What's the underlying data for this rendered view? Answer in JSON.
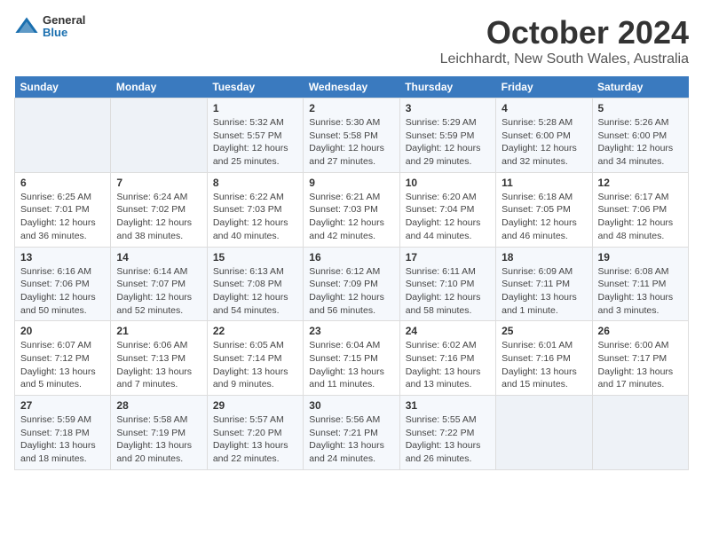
{
  "logo": {
    "general": "General",
    "blue": "Blue"
  },
  "title": "October 2024",
  "subtitle": "Leichhardt, New South Wales, Australia",
  "headers": [
    "Sunday",
    "Monday",
    "Tuesday",
    "Wednesday",
    "Thursday",
    "Friday",
    "Saturday"
  ],
  "weeks": [
    [
      {
        "day": "",
        "info": ""
      },
      {
        "day": "",
        "info": ""
      },
      {
        "day": "1",
        "info": "Sunrise: 5:32 AM\nSunset: 5:57 PM\nDaylight: 12 hours\nand 25 minutes."
      },
      {
        "day": "2",
        "info": "Sunrise: 5:30 AM\nSunset: 5:58 PM\nDaylight: 12 hours\nand 27 minutes."
      },
      {
        "day": "3",
        "info": "Sunrise: 5:29 AM\nSunset: 5:59 PM\nDaylight: 12 hours\nand 29 minutes."
      },
      {
        "day": "4",
        "info": "Sunrise: 5:28 AM\nSunset: 6:00 PM\nDaylight: 12 hours\nand 32 minutes."
      },
      {
        "day": "5",
        "info": "Sunrise: 5:26 AM\nSunset: 6:00 PM\nDaylight: 12 hours\nand 34 minutes."
      }
    ],
    [
      {
        "day": "6",
        "info": "Sunrise: 6:25 AM\nSunset: 7:01 PM\nDaylight: 12 hours\nand 36 minutes."
      },
      {
        "day": "7",
        "info": "Sunrise: 6:24 AM\nSunset: 7:02 PM\nDaylight: 12 hours\nand 38 minutes."
      },
      {
        "day": "8",
        "info": "Sunrise: 6:22 AM\nSunset: 7:03 PM\nDaylight: 12 hours\nand 40 minutes."
      },
      {
        "day": "9",
        "info": "Sunrise: 6:21 AM\nSunset: 7:03 PM\nDaylight: 12 hours\nand 42 minutes."
      },
      {
        "day": "10",
        "info": "Sunrise: 6:20 AM\nSunset: 7:04 PM\nDaylight: 12 hours\nand 44 minutes."
      },
      {
        "day": "11",
        "info": "Sunrise: 6:18 AM\nSunset: 7:05 PM\nDaylight: 12 hours\nand 46 minutes."
      },
      {
        "day": "12",
        "info": "Sunrise: 6:17 AM\nSunset: 7:06 PM\nDaylight: 12 hours\nand 48 minutes."
      }
    ],
    [
      {
        "day": "13",
        "info": "Sunrise: 6:16 AM\nSunset: 7:06 PM\nDaylight: 12 hours\nand 50 minutes."
      },
      {
        "day": "14",
        "info": "Sunrise: 6:14 AM\nSunset: 7:07 PM\nDaylight: 12 hours\nand 52 minutes."
      },
      {
        "day": "15",
        "info": "Sunrise: 6:13 AM\nSunset: 7:08 PM\nDaylight: 12 hours\nand 54 minutes."
      },
      {
        "day": "16",
        "info": "Sunrise: 6:12 AM\nSunset: 7:09 PM\nDaylight: 12 hours\nand 56 minutes."
      },
      {
        "day": "17",
        "info": "Sunrise: 6:11 AM\nSunset: 7:10 PM\nDaylight: 12 hours\nand 58 minutes."
      },
      {
        "day": "18",
        "info": "Sunrise: 6:09 AM\nSunset: 7:11 PM\nDaylight: 13 hours\nand 1 minute."
      },
      {
        "day": "19",
        "info": "Sunrise: 6:08 AM\nSunset: 7:11 PM\nDaylight: 13 hours\nand 3 minutes."
      }
    ],
    [
      {
        "day": "20",
        "info": "Sunrise: 6:07 AM\nSunset: 7:12 PM\nDaylight: 13 hours\nand 5 minutes."
      },
      {
        "day": "21",
        "info": "Sunrise: 6:06 AM\nSunset: 7:13 PM\nDaylight: 13 hours\nand 7 minutes."
      },
      {
        "day": "22",
        "info": "Sunrise: 6:05 AM\nSunset: 7:14 PM\nDaylight: 13 hours\nand 9 minutes."
      },
      {
        "day": "23",
        "info": "Sunrise: 6:04 AM\nSunset: 7:15 PM\nDaylight: 13 hours\nand 11 minutes."
      },
      {
        "day": "24",
        "info": "Sunrise: 6:02 AM\nSunset: 7:16 PM\nDaylight: 13 hours\nand 13 minutes."
      },
      {
        "day": "25",
        "info": "Sunrise: 6:01 AM\nSunset: 7:16 PM\nDaylight: 13 hours\nand 15 minutes."
      },
      {
        "day": "26",
        "info": "Sunrise: 6:00 AM\nSunset: 7:17 PM\nDaylight: 13 hours\nand 17 minutes."
      }
    ],
    [
      {
        "day": "27",
        "info": "Sunrise: 5:59 AM\nSunset: 7:18 PM\nDaylight: 13 hours\nand 18 minutes."
      },
      {
        "day": "28",
        "info": "Sunrise: 5:58 AM\nSunset: 7:19 PM\nDaylight: 13 hours\nand 20 minutes."
      },
      {
        "day": "29",
        "info": "Sunrise: 5:57 AM\nSunset: 7:20 PM\nDaylight: 13 hours\nand 22 minutes."
      },
      {
        "day": "30",
        "info": "Sunrise: 5:56 AM\nSunset: 7:21 PM\nDaylight: 13 hours\nand 24 minutes."
      },
      {
        "day": "31",
        "info": "Sunrise: 5:55 AM\nSunset: 7:22 PM\nDaylight: 13 hours\nand 26 minutes."
      },
      {
        "day": "",
        "info": ""
      },
      {
        "day": "",
        "info": ""
      }
    ]
  ]
}
